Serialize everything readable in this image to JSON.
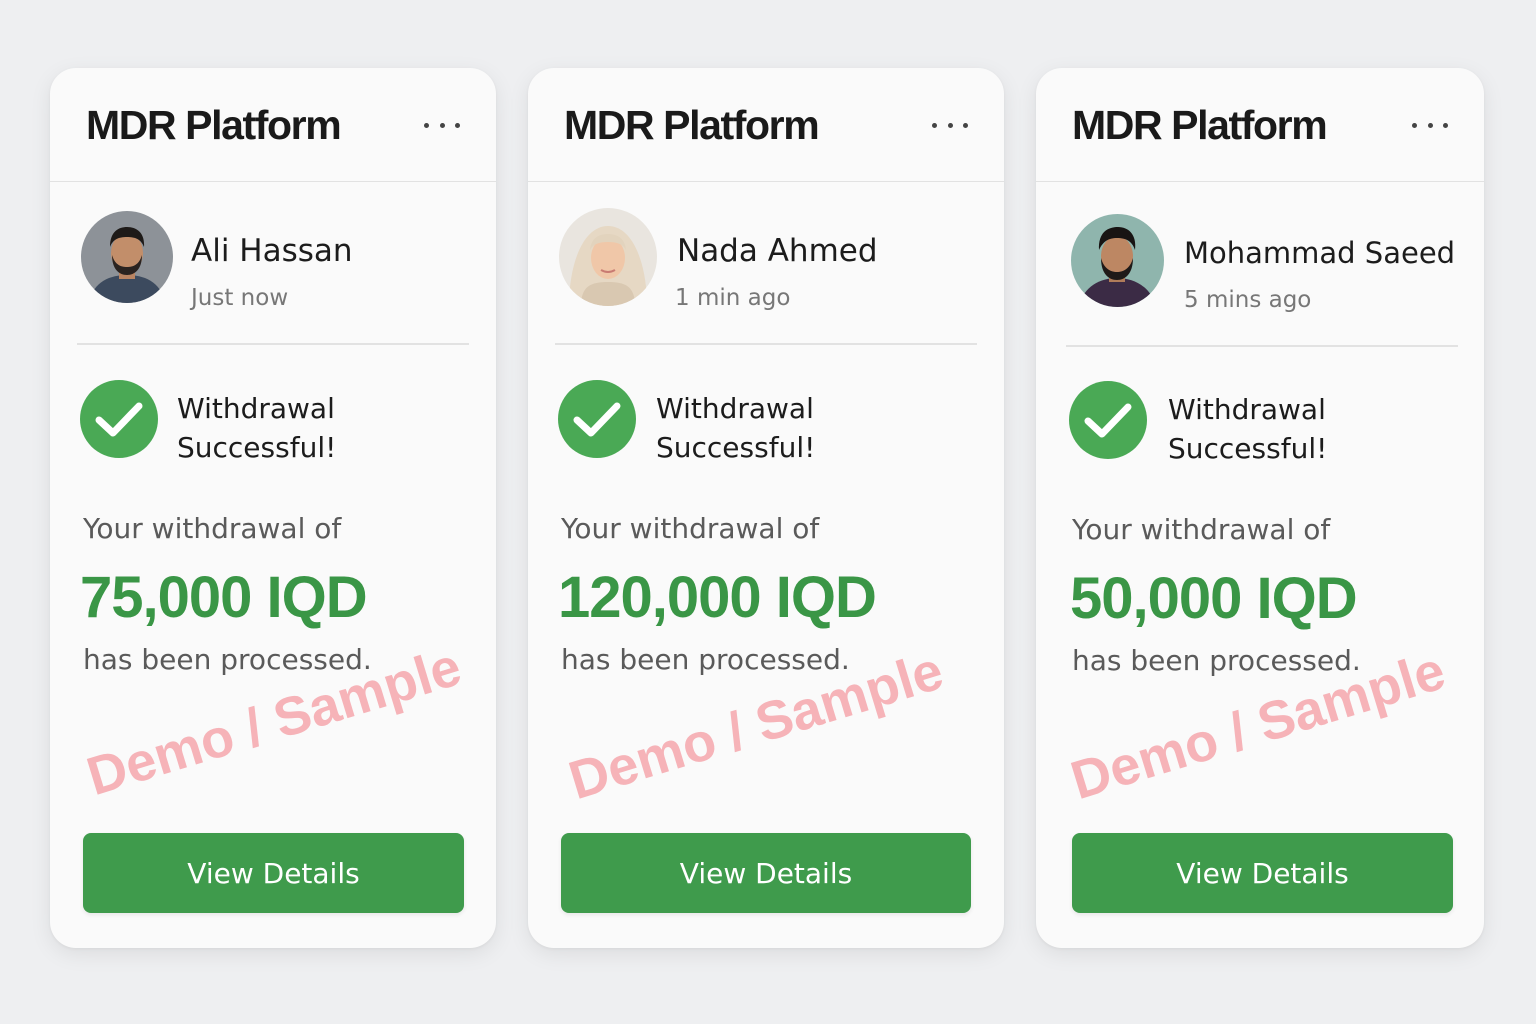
{
  "accent_color": "#3a9646",
  "button_color": "#3f9b4c",
  "watermark_color": "#f27882",
  "cards": [
    {
      "brand": "MDR Platform",
      "menu_icon": "more-horizontal-icon",
      "user_name": "Ali Hassan",
      "time": "Just now",
      "status_title": "Withdrawal Successful!",
      "lead_text": "Your withdrawal of",
      "amount": "75,000 IQD",
      "trail_text": "has been processed.",
      "watermark": "Demo / Sample",
      "button_label": "View Details"
    },
    {
      "brand": "MDR Platform",
      "menu_icon": "more-horizontal-icon",
      "user_name": "Nada Ahmed",
      "time": "1 min ago",
      "status_title": "Withdrawal Successful!",
      "lead_text": "Your withdrawal of",
      "amount": "120,000 IQD",
      "trail_text": "has been processed.",
      "watermark": "Demo / Sample",
      "button_label": "View Details"
    },
    {
      "brand": "MDR Platform",
      "menu_icon": "more-horizontal-icon",
      "user_name": "Mohammad Saeed",
      "time": "5 mins ago",
      "status_title": "Withdrawal Successful!",
      "lead_text": "Your withdrawal of",
      "amount": "50,000 IQD",
      "trail_text": "has been processed.",
      "watermark": "Demo / Sample",
      "button_label": "View Details"
    }
  ]
}
